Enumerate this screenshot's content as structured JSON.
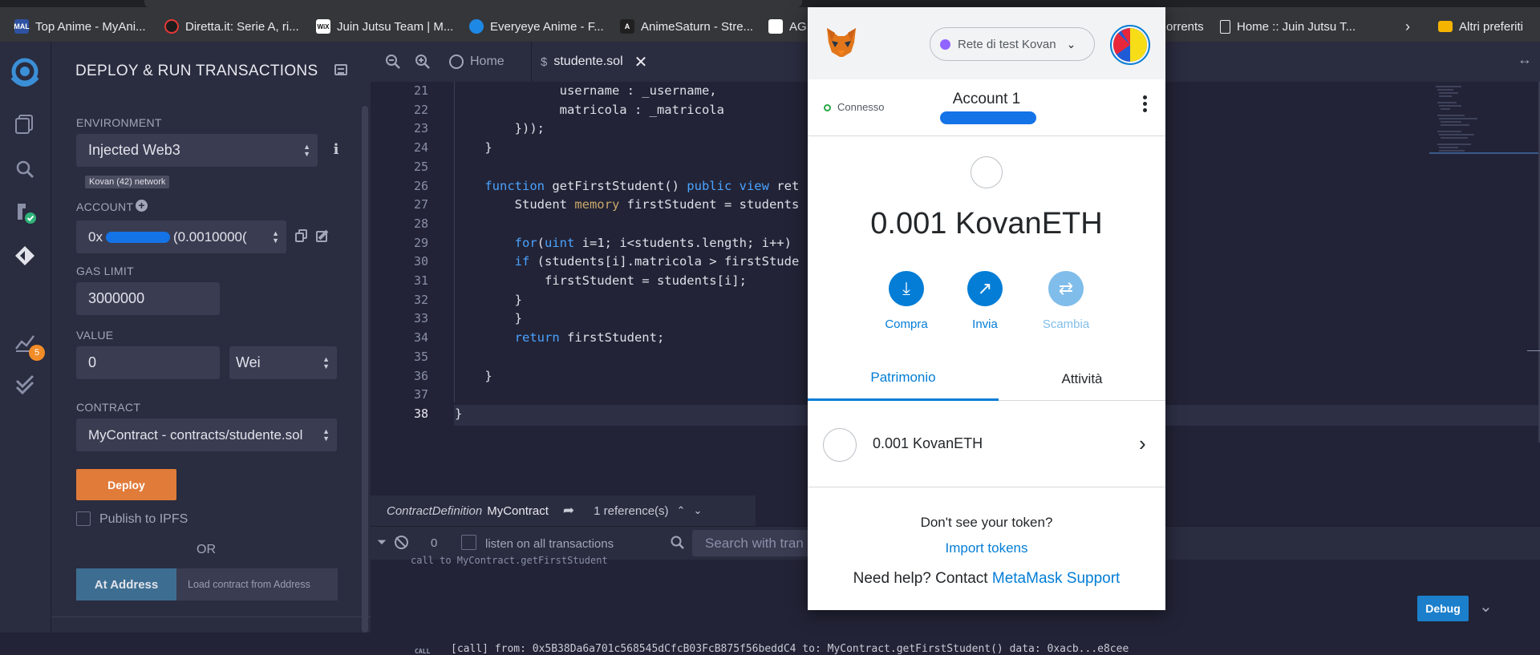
{
  "bookmarks": [
    {
      "label": "Top Anime - MyAni...",
      "icon": "MAL",
      "color": "#2e51a2"
    },
    {
      "label": "Diretta.it: Serie A, ri...",
      "icon": "D",
      "color": "#1d1d1d"
    },
    {
      "label": "Juin Jutsu Team | M...",
      "icon": "WiX",
      "color": "#111111"
    },
    {
      "label": "Everyeye Anime - F...",
      "icon": "E",
      "color": "#1e88e5"
    },
    {
      "label": "AnimeSaturn - Stre...",
      "icon": "A",
      "color": "#202020"
    },
    {
      "label": "AG",
      "icon": "G",
      "color": "#202020"
    },
    {
      "label": "orrents",
      "icon": "",
      "color": ""
    },
    {
      "label": "Home :: Juin Jutsu T...",
      "icon": "doc",
      "color": ""
    },
    {
      "label": "Altri preferiti",
      "icon": "folder",
      "color": "#f4b400"
    }
  ],
  "sidebar": {
    "badge": "5",
    "icons": [
      "remix-logo-icon",
      "file-explorer-icon",
      "search-icon",
      "compiler-icon",
      "deploy-icon",
      "analysis-icon",
      "test-icon"
    ]
  },
  "deploy": {
    "title": "DEPLOY & RUN TRANSACTIONS",
    "environment_label": "ENVIRONMENT",
    "environment_value": "Injected Web3",
    "network_badge": "Kovan (42) network",
    "account_label": "ACCOUNT",
    "account_value": "0x",
    "account_balance": "(0.0010000(",
    "gas_label": "GAS LIMIT",
    "gas_value": "3000000",
    "value_label": "VALUE",
    "value_amount": "0",
    "value_unit": "Wei",
    "contract_label": "CONTRACT",
    "contract_value": "MyContract - contracts/studente.sol",
    "deploy_button": "Deploy",
    "publish_ipfs": "Publish to IPFS",
    "or_text": "OR",
    "at_address_button": "At Address",
    "at_address_placeholder": "Load contract from Address"
  },
  "editor": {
    "tabs": [
      {
        "label": "Home"
      },
      {
        "label": "studente.sol"
      }
    ],
    "lines": [
      {
        "n": "21",
        "code": "              username : _username,"
      },
      {
        "n": "22",
        "code": "              matricola : _matricola"
      },
      {
        "n": "23",
        "code": "        }));"
      },
      {
        "n": "24",
        "code": "    }"
      },
      {
        "n": "25",
        "code": ""
      },
      {
        "n": "26",
        "code": "    function getFirstStudent() public view ret"
      },
      {
        "n": "27",
        "code": "        Student memory firstStudent = students"
      },
      {
        "n": "28",
        "code": ""
      },
      {
        "n": "29",
        "code": "        for(uint i=1; i<students.length; i++)"
      },
      {
        "n": "30",
        "code": "        if (students[i].matricola > firstStude"
      },
      {
        "n": "31",
        "code": "            firstStudent = students[i];"
      },
      {
        "n": "32",
        "code": "        }"
      },
      {
        "n": "33",
        "code": "        }"
      },
      {
        "n": "34",
        "code": "        return firstStudent;"
      },
      {
        "n": "35",
        "code": ""
      },
      {
        "n": "36",
        "code": "    }"
      },
      {
        "n": "37",
        "code": ""
      },
      {
        "n": "38",
        "code": "}"
      }
    ],
    "ref_kind": "ContractDefinition",
    "ref_name": "MyContract",
    "ref_count": "1 reference(s)",
    "term_count": "0",
    "listen_label": "listen on all transactions",
    "search_placeholder": "Search with tran",
    "log_line_1": "call to MyContract.getFirstStudent",
    "log_tag": "CALL",
    "log_line_2": "[call]  from: 0x5B38Da6a701c568545dCfcB03FcB875f56beddC4 to: MyContract.getFirstStudent() data: 0xacb...e8cee",
    "debug_button": "Debug"
  },
  "metamask": {
    "network": "Rete di test Kovan",
    "connected": "Connesso",
    "account_name": "Account 1",
    "balance": "0.001 KovanETH",
    "actions": [
      {
        "label": "Compra"
      },
      {
        "label": "Invia"
      },
      {
        "label": "Scambia"
      }
    ],
    "tab_assets": "Patrimonio",
    "tab_activity": "Attività",
    "asset_row": "0.001 KovanETH",
    "no_token": "Don't see your token?",
    "import_tokens": "Import tokens",
    "help_prefix": "Need help? Contact",
    "help_link": "MetaMask Support"
  },
  "colors": {
    "accent": "#037dd6",
    "deploy_button": "#e07b39",
    "remix_bg": "#2a2c3f"
  }
}
